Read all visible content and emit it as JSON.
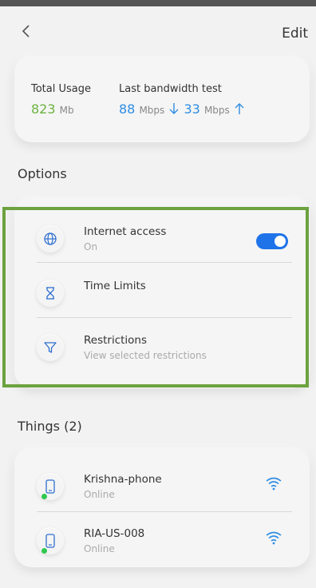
{
  "header": {
    "edit_label": "Edit"
  },
  "usage": {
    "total_label": "Total Usage",
    "total_value": "823",
    "total_unit": "Mb",
    "bandwidth_label": "Last bandwidth test",
    "down_value": "88",
    "down_unit": "Mbps",
    "up_value": "33",
    "up_unit": "Mbps"
  },
  "options": {
    "title": "Options",
    "items": [
      {
        "title": "Internet access",
        "subtitle": "On",
        "icon": "globe-icon",
        "toggle_on": true
      },
      {
        "title": "Time Limits",
        "subtitle": "",
        "icon": "hourglass-icon"
      },
      {
        "title": "Restrictions",
        "subtitle": "View selected restrictions",
        "icon": "filter-icon"
      }
    ]
  },
  "things": {
    "title": "Things (2)",
    "items": [
      {
        "name": "Krishna-phone",
        "status": "Online",
        "icon": "phone-icon"
      },
      {
        "name": "RIA-US-008",
        "status": "Online",
        "icon": "phone-icon"
      }
    ]
  },
  "colors": {
    "accent": "#2f8de4",
    "usage_green": "#6cb33f",
    "toggle_blue": "#1e73e8",
    "online_dot": "#2fc84f",
    "highlight_border": "#6ca23f"
  }
}
